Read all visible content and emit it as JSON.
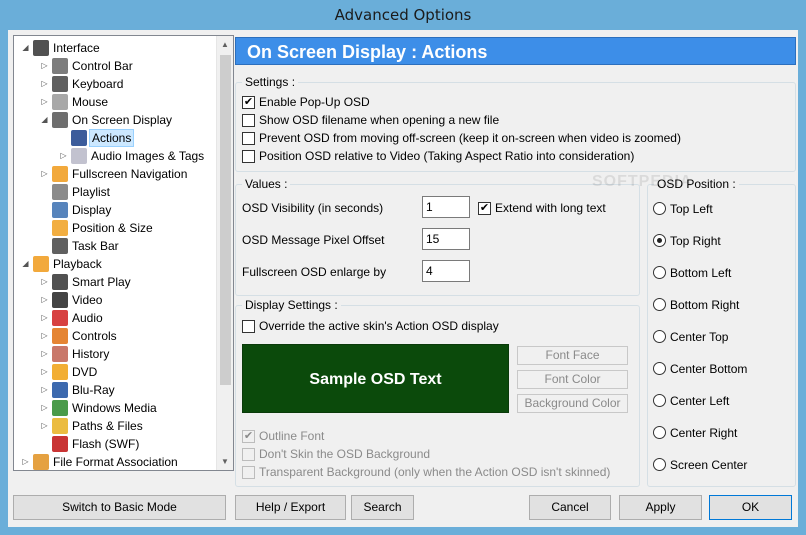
{
  "window": {
    "title": "Advanced Options"
  },
  "tree": {
    "items": [
      {
        "label": "Interface",
        "icon": "monitor-icon",
        "expander": "open"
      },
      {
        "label": "Control Bar",
        "icon": "control-bar-icon",
        "expander": "closed"
      },
      {
        "label": "Keyboard",
        "icon": "keyboard-icon",
        "expander": "closed"
      },
      {
        "label": "Mouse",
        "icon": "mouse-icon",
        "expander": "closed"
      },
      {
        "label": "On Screen Display",
        "icon": "osd-icon",
        "expander": "open"
      },
      {
        "label": "Actions",
        "icon": "runner-icon",
        "expander": "none",
        "selected": true
      },
      {
        "label": "Audio Images & Tags",
        "icon": "audio-images-icon",
        "expander": "closed"
      },
      {
        "label": "Fullscreen Navigation",
        "icon": "fullscreen-icon",
        "expander": "closed"
      },
      {
        "label": "Playlist",
        "icon": "playlist-icon",
        "expander": "none"
      },
      {
        "label": "Display",
        "icon": "display-icon",
        "expander": "none"
      },
      {
        "label": "Position & Size",
        "icon": "position-icon",
        "expander": "none"
      },
      {
        "label": "Task Bar",
        "icon": "taskbar-icon",
        "expander": "none"
      },
      {
        "label": "Playback",
        "icon": "play-icon",
        "expander": "open"
      },
      {
        "label": "Smart Play",
        "icon": "smart-play-icon",
        "expander": "closed"
      },
      {
        "label": "Video",
        "icon": "film-icon",
        "expander": "closed"
      },
      {
        "label": "Audio",
        "icon": "music-note-icon",
        "expander": "closed"
      },
      {
        "label": "Controls",
        "icon": "controls-icon",
        "expander": "closed"
      },
      {
        "label": "History",
        "icon": "history-icon",
        "expander": "closed"
      },
      {
        "label": "DVD",
        "icon": "dvd-icon",
        "expander": "closed"
      },
      {
        "label": "Blu-Ray",
        "icon": "bluray-icon",
        "expander": "closed"
      },
      {
        "label": "Windows Media",
        "icon": "windows-media-icon",
        "expander": "closed"
      },
      {
        "label": "Paths & Files",
        "icon": "folder-icon",
        "expander": "closed"
      },
      {
        "label": "Flash (SWF)",
        "icon": "flash-icon",
        "expander": "none"
      },
      {
        "label": "File Format Association",
        "icon": "file-association-icon",
        "expander": "closed"
      }
    ]
  },
  "header": {
    "title": "On Screen Display : Actions",
    "color": "#3d8ee8"
  },
  "settings": {
    "title": "Settings :",
    "options": [
      {
        "label": "Enable Pop-Up OSD",
        "checked": true
      },
      {
        "label": "Show OSD filename when opening a new file",
        "checked": false
      },
      {
        "label": "Prevent OSD from moving off-screen (keep it on-screen when video is zoomed)",
        "checked": false
      },
      {
        "label": "Position OSD relative to Video (Taking Aspect Ratio into consideration)",
        "checked": false
      }
    ]
  },
  "values": {
    "title": "Values :",
    "visibility_label": "OSD Visibility (in seconds)",
    "visibility_value": "1",
    "extend_label": "Extend with long text",
    "extend_checked": true,
    "offset_label": "OSD Message Pixel Offset",
    "offset_value": "15",
    "enlarge_label": "Fullscreen OSD enlarge by",
    "enlarge_value": "4"
  },
  "display_settings": {
    "title": "Display Settings :",
    "override_label": "Override the active skin's Action OSD display",
    "override_checked": false,
    "sample_text": "Sample OSD Text",
    "sample_bg": "#0b4a0b",
    "font_face_label": "Font Face",
    "font_color_label": "Font Color",
    "background_color_label": "Background Color",
    "outline_label": "Outline Font",
    "outline_checked": true,
    "dont_skin_label": "Don't Skin the OSD Background",
    "transparent_label": "Transparent Background (only when the Action OSD isn't skinned)"
  },
  "osd_position": {
    "title": "OSD Position :",
    "selected": "Top Right",
    "options": [
      "Top Left",
      "Top Right",
      "Bottom Left",
      "Bottom Right",
      "Center Top",
      "Center Bottom",
      "Center Left",
      "Center Right",
      "Screen Center"
    ]
  },
  "buttons": {
    "basic_mode": "Switch to Basic Mode",
    "help_export": "Help / Export",
    "search": "Search",
    "cancel": "Cancel",
    "apply": "Apply",
    "ok": "OK"
  },
  "watermark": "SOFTPEDIA"
}
